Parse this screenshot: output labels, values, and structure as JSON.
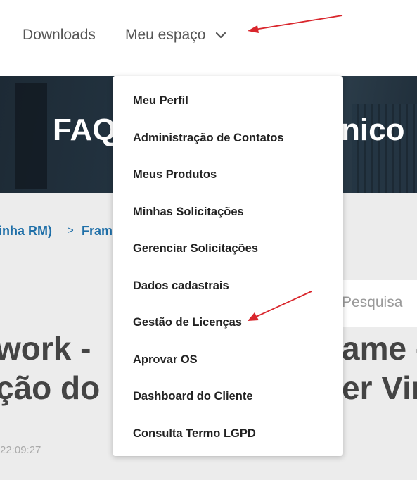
{
  "nav": {
    "downloads_label": "Downloads",
    "meu_espaco_label": "Meu espaço",
    "chevron_icon": "chevron-down-icon"
  },
  "hero": {
    "title_left": "FAQ",
    "title_right": "nico"
  },
  "breadcrumb": {
    "item1": "inha RM)",
    "separator": ">",
    "item2": "Fram"
  },
  "search": {
    "placeholder": "Pesquisa"
  },
  "article": {
    "line1_left": "work -",
    "line1_right": "ame -",
    "line2_left": "ção do",
    "line2_right": "er Vir",
    "timestamp": "22:09:27"
  },
  "dropdown": {
    "items": [
      "Meu Perfil",
      "Administração de Contatos",
      "Meus Produtos",
      "Minhas Solicitações",
      "Gerenciar Solicitações",
      "Dados cadastrais",
      "Gestão de Licenças",
      "Aprovar OS",
      "Dashboard do Cliente",
      "Consulta Termo LGPD"
    ]
  },
  "colors": {
    "link_blue": "#1f6fa8",
    "annotation_red": "#d9262c",
    "hero_bg": "#1a2733"
  }
}
